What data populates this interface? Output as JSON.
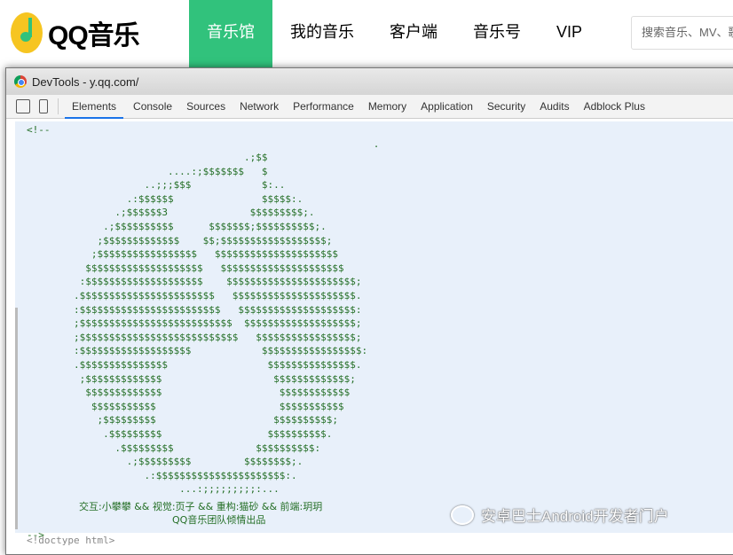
{
  "header": {
    "logo": "QQ音乐",
    "nav": [
      "音乐馆",
      "我的音乐",
      "客户端",
      "音乐号",
      "VIP"
    ],
    "search_placeholder": "搜索音乐、MV、歌单"
  },
  "devtools": {
    "title": "DevTools - y.qq.com/",
    "tabs": [
      "Elements",
      "Console",
      "Sources",
      "Network",
      "Performance",
      "Memory",
      "Application",
      "Security",
      "Audits",
      "Adblock Plus"
    ]
  },
  "source": {
    "comment_open": "<!--",
    "art": [
      "                                                           .",
      "                                     .;$$",
      "                        ....:;$$$$$$$   $",
      "                    ..;;;$$$            $:..",
      "                 .:$$$$$$               $$$$$:.",
      "               .;$$$$$$3              $$$$$$$$$;.",
      "             .;$$$$$$$$$$      $$$$$$$;$$$$$$$$$$;.",
      "            ;$$$$$$$$$$$$$    $$;$$$$$$$$$$$$$$$$$$;",
      "           ;$$$$$$$$$$$$$$$$$   $$$$$$$$$$$$$$$$$$$$$",
      "          $$$$$$$$$$$$$$$$$$$$   $$$$$$$$$$$$$$$$$$$$$",
      "         :$$$$$$$$$$$$$$$$$$$$    $$$$$$$$$$$$$$$$$$$$$$;",
      "        .$$$$$$$$$$$$$$$$$$$$$$$   $$$$$$$$$$$$$$$$$$$$$.",
      "        :$$$$$$$$$$$$$$$$$$$$$$$$   $$$$$$$$$$$$$$$$$$$$:",
      "        ;$$$$$$$$$$$$$$$$$$$$$$$$$$  $$$$$$$$$$$$$$$$$$$;",
      "        ;$$$$$$$$$$$$$$$$$$$$$$$$$$$   $$$$$$$$$$$$$$$$$;",
      "        :$$$$$$$$$$$$$$$$$$$            $$$$$$$$$$$$$$$$$:",
      "        .$$$$$$$$$$$$$$$                 $$$$$$$$$$$$$$$.",
      "         ;$$$$$$$$$$$$$                   $$$$$$$$$$$$$;",
      "          $$$$$$$$$$$$$                    $$$$$$$$$$$$",
      "           $$$$$$$$$$$                     $$$$$$$$$$$",
      "            ;$$$$$$$$$                    $$$$$$$$$$;",
      "             .$$$$$$$$$                  $$$$$$$$$$.",
      "               .$$$$$$$$$              $$$$$$$$$$:",
      "                 .;$$$$$$$$$         $$$$$$$$;.",
      "                    .:$$$$$$$$$$$$$$$$$$$$$$:.",
      "                          ...:;;;;;;;;;:..."
    ],
    "credits": "交互:小攀攀 && 视觉:页子 && 重构:猫砂 && 前端:玥玥",
    "team": "QQ音乐团队倾情出品",
    "comment_close": "-->",
    "doctype": "<!doctype html>"
  },
  "watermark": "安卓巴士Android开发者门户",
  "colors": {
    "brand": "#31c27c",
    "comment": "#236e25",
    "selection": "#e8f0fa"
  }
}
